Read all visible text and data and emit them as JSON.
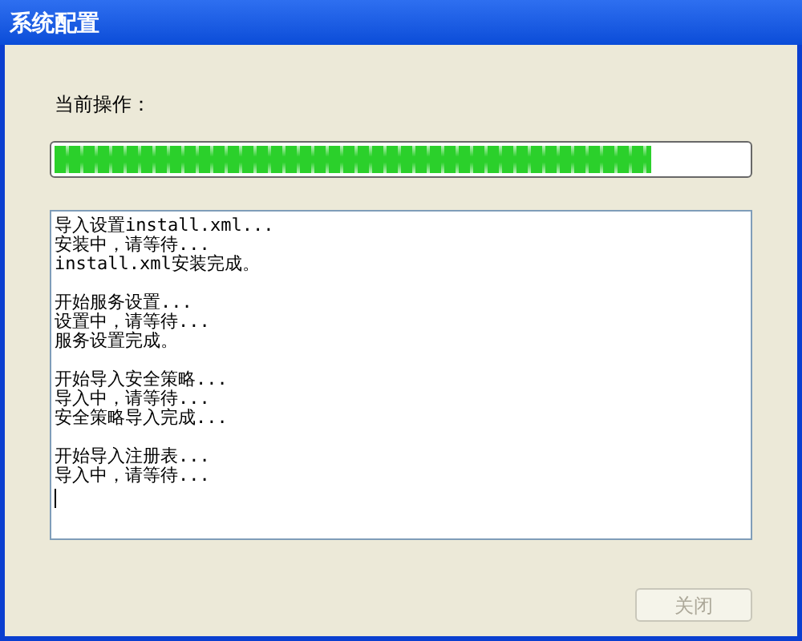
{
  "window": {
    "title": "系统配置"
  },
  "current_operation": {
    "label": "当前操作：",
    "progress": {
      "level": 0.86
    }
  },
  "log": {
    "blocks": [
      [
        "导入设置install.xml...",
        "安装中，请等待...",
        "install.xml安装完成。"
      ],
      [
        "开始服务设置...",
        "设置中，请等待...",
        "服务设置完成。"
      ],
      [
        "开始导入安全策略...",
        "导入中，请等待...",
        "安全策略导入完成..."
      ],
      [
        "开始导入注册表...",
        "导入中，请等待..."
      ]
    ]
  },
  "buttons": [
    {
      "label": "关闭",
      "disabled": true
    }
  ]
}
